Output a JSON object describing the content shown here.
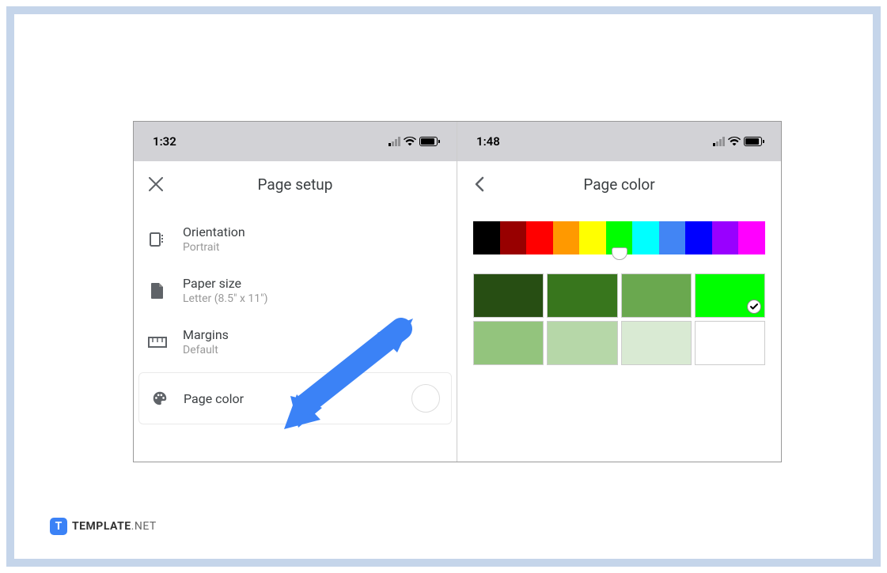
{
  "left_panel": {
    "status_time": "1:32",
    "header_title": "Page setup",
    "items": [
      {
        "title": "Orientation",
        "subtitle": "Portrait",
        "icon": "orientation-icon"
      },
      {
        "title": "Paper size",
        "subtitle": "Letter (8.5\" x 11\")",
        "icon": "paper-icon"
      },
      {
        "title": "Margins",
        "subtitle": "Default",
        "icon": "margins-icon"
      }
    ],
    "page_color_label": "Page color"
  },
  "right_panel": {
    "status_time": "1:48",
    "header_title": "Page color",
    "color_strip": [
      "#000000",
      "#980000",
      "#ff0000",
      "#ff9900",
      "#ffff00",
      "#00ff00",
      "#00ffff",
      "#4285f4",
      "#0000ff",
      "#9900ff",
      "#ff00ff"
    ],
    "selected_strip_index": 5,
    "shades_row1": [
      "#274e13",
      "#38761d",
      "#6aa84f",
      "#00ff00"
    ],
    "shades_row2": [
      "#93c47d",
      "#b6d7a8",
      "#d9ead3",
      "#ffffff"
    ],
    "selected_shade": {
      "row": 0,
      "col": 3
    }
  },
  "logo": {
    "icon_letter": "T",
    "text_main": "TEMPLATE",
    "text_suffix": ".NET"
  }
}
